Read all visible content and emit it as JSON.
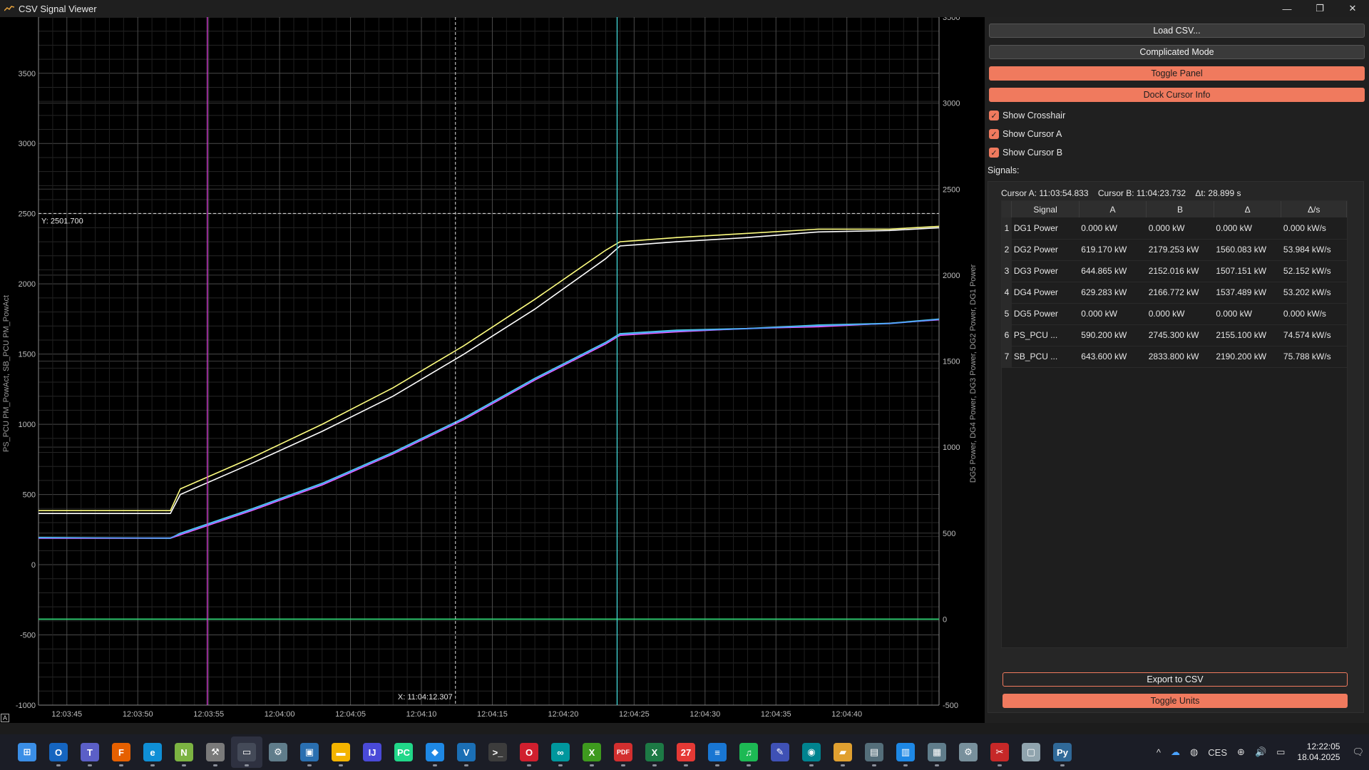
{
  "window": {
    "title": "CSV Signal Viewer",
    "controls": [
      "—",
      "❐",
      "✕"
    ]
  },
  "plot": {
    "left_axis_label": "PS_PCU PM_PowAct, SB_PCU PM_PowAct",
    "right_axis_label": "DG5 Power, DG4 Power, DG3 Power, DG2 Power, DG1 Power",
    "left_ticks": [
      "3500",
      "3000",
      "2500",
      "2000",
      "1500",
      "1000",
      "500",
      "0",
      "-500",
      "-1000"
    ],
    "right_ticks": [
      "3500",
      "3000",
      "2500",
      "2000",
      "1500",
      "1000",
      "500",
      "0",
      "-500"
    ],
    "x_ticks": [
      "12:03:45",
      "12:03:50",
      "12:03:55",
      "12:04:00",
      "12:04:05",
      "12:04:10",
      "12:04:15",
      "12:04:20",
      "12:04:25",
      "12:04:30",
      "12:04:35",
      "12:04:40"
    ],
    "crosshair_y_label": "Y: 2501.700",
    "crosshair_x_label": "X: 11:04:12.307",
    "corner_label": "A"
  },
  "chart_data": {
    "type": "line",
    "x_unit": "seconds after 12:03:43",
    "left_ylim": [
      -1000,
      3900
    ],
    "right_ylim": [
      -500,
      3500
    ],
    "cursor_a_x": 11.9,
    "cursor_b_x": 40.8,
    "crosshair_x": 29.4,
    "crosshair_y": 2501.7,
    "series": [
      {
        "name": "PS_PCU PM_PowAct",
        "axis": "left",
        "color": "#ffff80",
        "points": [
          [
            0,
            385
          ],
          [
            9.3,
            385
          ],
          [
            10,
            540
          ],
          [
            15,
            760
          ],
          [
            20,
            1000
          ],
          [
            25,
            1260
          ],
          [
            30,
            1560
          ],
          [
            35,
            1890
          ],
          [
            40,
            2240
          ],
          [
            41,
            2300
          ],
          [
            45,
            2330
          ],
          [
            50,
            2360
          ],
          [
            55,
            2390
          ],
          [
            60,
            2390
          ],
          [
            63.5,
            2410
          ]
        ]
      },
      {
        "name": "SB_PCU PM_PowAct",
        "axis": "left",
        "color": "#ffffff",
        "points": [
          [
            0,
            365
          ],
          [
            9.3,
            365
          ],
          [
            10,
            500
          ],
          [
            15,
            720
          ],
          [
            20,
            950
          ],
          [
            25,
            1200
          ],
          [
            30,
            1500
          ],
          [
            35,
            1820
          ],
          [
            40,
            2180
          ],
          [
            41,
            2270
          ],
          [
            45,
            2300
          ],
          [
            50,
            2330
          ],
          [
            55,
            2370
          ],
          [
            60,
            2380
          ],
          [
            63.5,
            2400
          ]
        ]
      },
      {
        "name": "DG2 Power",
        "axis": "right",
        "color": "#ff55ff",
        "points": [
          [
            0,
            470
          ],
          [
            9.3,
            470
          ],
          [
            10,
            490
          ],
          [
            15,
            630
          ],
          [
            20,
            780
          ],
          [
            25,
            960
          ],
          [
            30,
            1160
          ],
          [
            35,
            1390
          ],
          [
            40,
            1600
          ],
          [
            41,
            1650
          ],
          [
            45,
            1670
          ],
          [
            50,
            1690
          ],
          [
            55,
            1700
          ],
          [
            60,
            1720
          ],
          [
            63.5,
            1740
          ]
        ]
      },
      {
        "name": "DG3 Power",
        "axis": "right",
        "color": "#4fd1e6",
        "points": [
          [
            0,
            475
          ],
          [
            9.3,
            470
          ],
          [
            10,
            500
          ],
          [
            15,
            640
          ],
          [
            20,
            790
          ],
          [
            25,
            970
          ],
          [
            30,
            1170
          ],
          [
            35,
            1400
          ],
          [
            40,
            1610
          ],
          [
            41,
            1660
          ],
          [
            45,
            1680
          ],
          [
            50,
            1690
          ],
          [
            55,
            1710
          ],
          [
            60,
            1720
          ],
          [
            63.5,
            1745
          ]
        ]
      },
      {
        "name": "DG4 Power",
        "axis": "right",
        "color": "#5599ff",
        "points": [
          [
            0,
            472
          ],
          [
            9.3,
            472
          ],
          [
            10,
            495
          ],
          [
            15,
            635
          ],
          [
            20,
            785
          ],
          [
            25,
            965
          ],
          [
            30,
            1165
          ],
          [
            35,
            1395
          ],
          [
            40,
            1605
          ],
          [
            41,
            1655
          ],
          [
            45,
            1675
          ],
          [
            50,
            1688
          ],
          [
            55,
            1705
          ],
          [
            60,
            1718
          ],
          [
            63.5,
            1742
          ]
        ]
      },
      {
        "name": "DG1 Power",
        "axis": "right",
        "color": "#3ddc84",
        "points": [
          [
            0,
            0
          ],
          [
            63.5,
            0
          ]
        ]
      },
      {
        "name": "DG5 Power",
        "axis": "right",
        "color": "#2ecc71",
        "points": [
          [
            0,
            0
          ],
          [
            63.5,
            0
          ]
        ]
      }
    ]
  },
  "panel": {
    "buttons": {
      "load_csv": "Load CSV...",
      "complicated_mode": "Complicated Mode",
      "toggle_panel": "Toggle Panel",
      "dock_cursor_info": "Dock Cursor Info"
    },
    "checkboxes": {
      "show_crosshair": "Show Crosshair",
      "show_cursor_a": "Show Cursor A",
      "show_cursor_b": "Show Cursor B"
    },
    "check_mark": "✓",
    "signals_label": "Signals:",
    "cursor_info": {
      "cursor_a": "Cursor A: 11:03:54.833",
      "cursor_b": "Cursor B: 11:04:23.732",
      "delta_t": "Δt: 28.899 s"
    },
    "table": {
      "headers": [
        "Signal",
        "A",
        "B",
        "Δ",
        "Δ/s"
      ],
      "rows": [
        {
          "idx": "1",
          "signal": "DG1 Power",
          "a": "0.000 kW",
          "b": "0.000 kW",
          "d": "0.000 kW",
          "ds": "0.000 kW/s"
        },
        {
          "idx": "2",
          "signal": "DG2 Power",
          "a": "619.170 kW",
          "b": "2179.253 kW",
          "d": "1560.083 kW",
          "ds": "53.984 kW/s"
        },
        {
          "idx": "3",
          "signal": "DG3 Power",
          "a": "644.865 kW",
          "b": "2152.016 kW",
          "d": "1507.151 kW",
          "ds": "52.152 kW/s"
        },
        {
          "idx": "4",
          "signal": "DG4 Power",
          "a": "629.283 kW",
          "b": "2166.772 kW",
          "d": "1537.489 kW",
          "ds": "53.202 kW/s"
        },
        {
          "idx": "5",
          "signal": "DG5 Power",
          "a": "0.000 kW",
          "b": "0.000 kW",
          "d": "0.000 kW",
          "ds": "0.000 kW/s"
        },
        {
          "idx": "6",
          "signal": "PS_PCU ...",
          "a": "590.200 kW",
          "b": "2745.300 kW",
          "d": "2155.100 kW",
          "ds": "74.574 kW/s"
        },
        {
          "idx": "7",
          "signal": "SB_PCU ...",
          "a": "643.600 kW",
          "b": "2833.800 kW",
          "d": "2190.200 kW",
          "ds": "75.788 kW/s"
        }
      ]
    },
    "export_csv": "Export to CSV",
    "toggle_units": "Toggle Units"
  },
  "taskbar": {
    "icons": [
      {
        "name": "windows-start-icon",
        "glyph": "⊞",
        "color": "#3a8ee6"
      },
      {
        "name": "outlook-icon",
        "glyph": "O",
        "color": "#1565c0"
      },
      {
        "name": "teams-icon",
        "glyph": "T",
        "color": "#5b5fc7"
      },
      {
        "name": "firefox-icon",
        "glyph": "F",
        "color": "#e66000"
      },
      {
        "name": "edge-icon",
        "glyph": "e",
        "color": "#0f8fd6"
      },
      {
        "name": "notepad-plus-icon",
        "glyph": "N",
        "color": "#7cb342"
      },
      {
        "name": "tools-icon",
        "glyph": "⚒",
        "color": "#7a7a7a"
      },
      {
        "name": "csv-viewer-icon",
        "glyph": "▭",
        "color": "#444a58"
      },
      {
        "name": "control-panel-icon",
        "glyph": "⚙",
        "color": "#607d8b"
      },
      {
        "name": "remote-desktop-icon",
        "glyph": "▣",
        "color": "#2a6fb0"
      },
      {
        "name": "file-explorer-icon",
        "glyph": "▬",
        "color": "#f4b400"
      },
      {
        "name": "intellij-icon",
        "glyph": "IJ",
        "color": "#4a4ad8"
      },
      {
        "name": "pycharm-icon",
        "glyph": "PC",
        "color": "#21d789"
      },
      {
        "name": "vscode-icon",
        "glyph": "◆",
        "color": "#1e88e5"
      },
      {
        "name": "virtualbox-icon",
        "glyph": "V",
        "color": "#1b6fb5"
      },
      {
        "name": "terminal-icon",
        "glyph": ">_",
        "color": "#3c3c3c"
      },
      {
        "name": "opera-icon",
        "glyph": "O",
        "color": "#d01f2e"
      },
      {
        "name": "arduino-icon",
        "glyph": "∞",
        "color": "#00979d"
      },
      {
        "name": "xbox-icon",
        "glyph": "X",
        "color": "#3e9a1e"
      },
      {
        "name": "pdf-icon",
        "glyph": "PDF",
        "color": "#d32f2f"
      },
      {
        "name": "excel-icon",
        "glyph": "X",
        "color": "#1d7a45"
      },
      {
        "name": "calendar-icon",
        "glyph": "27",
        "color": "#e53935"
      },
      {
        "name": "notes-icon",
        "glyph": "≡",
        "color": "#1976d2"
      },
      {
        "name": "spotify-icon",
        "glyph": "♫",
        "color": "#1db954"
      },
      {
        "name": "paint-icon",
        "glyph": "✎",
        "color": "#3f51b5"
      },
      {
        "name": "globe-icon",
        "glyph": "◉",
        "color": "#00838f"
      },
      {
        "name": "folder-icon",
        "glyph": "▰",
        "color": "#e0a030"
      },
      {
        "name": "monitor-icon",
        "glyph": "▤",
        "color": "#546e7a"
      },
      {
        "name": "screen-icon",
        "glyph": "▥",
        "color": "#1e88e5"
      },
      {
        "name": "calculator-icon",
        "glyph": "▦",
        "color": "#607d8b"
      },
      {
        "name": "settings-icon",
        "glyph": "⚙",
        "color": "#78909c"
      },
      {
        "name": "snip-icon",
        "glyph": "✂",
        "color": "#c62828"
      },
      {
        "name": "window-icon",
        "glyph": "▢",
        "color": "#90a4ae"
      },
      {
        "name": "python-icon",
        "glyph": "Py",
        "color": "#306998"
      }
    ],
    "tray": {
      "chevron": "^",
      "cloud": "☁",
      "network": "◍",
      "language": "CES",
      "globe": "⊕",
      "volume": "🔊",
      "battery": "▭",
      "time": "12:22:05",
      "date": "18.04.2025",
      "notify": "🗨"
    }
  }
}
